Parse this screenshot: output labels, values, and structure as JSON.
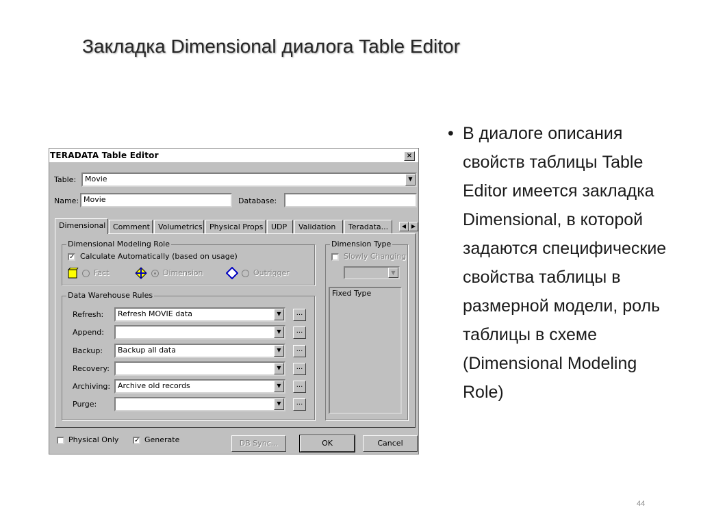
{
  "slide": {
    "title": "Закладка Dimensional диалога Table Editor",
    "bullet": "В диалоге описания свойств таблицы Table Editor имеется закладка Dimensional, в которой задаются специфические свойства таблицы в размерной модели, роль таблицы в схеме (Dimensional Modeling Role)",
    "page_number": "44"
  },
  "dialog": {
    "title": "TERADATA Table Editor",
    "close": "×",
    "table_label": "Table:",
    "table_value": "Movie",
    "name_label": "Name:",
    "name_value": "Movie",
    "database_label": "Database:",
    "database_value": "",
    "tabs": [
      "Dimensional",
      "Comment",
      "Volumetrics",
      "Physical Props",
      "UDP",
      "Validation",
      "Teradata..."
    ],
    "modeling_role": {
      "label": "Dimensional Modeling Role",
      "calc_auto": "Calculate Automatically (based on usage)",
      "calc_auto_checked": true,
      "fact": "Fact",
      "dimension": "Dimension",
      "outrigger": "Outrigger",
      "selected": "Dimension"
    },
    "dimension_type": {
      "label": "Dimension Type",
      "slowly_changing": "Slowly Changing",
      "slowly_changing_checked": false,
      "fixed_type": "Fixed Type"
    },
    "warehouse_rules": {
      "label": "Data Warehouse Rules",
      "rows": [
        {
          "label": "Refresh:",
          "value": "Refresh MOVIE data"
        },
        {
          "label": "Append:",
          "value": ""
        },
        {
          "label": "Backup:",
          "value": "Backup all data"
        },
        {
          "label": "Recovery:",
          "value": ""
        },
        {
          "label": "Archiving:",
          "value": "Archive old records"
        },
        {
          "label": "Purge:",
          "value": ""
        }
      ],
      "ellipsis": "..."
    },
    "physical_only": "Physical Only",
    "physical_only_checked": false,
    "generate": "Generate",
    "generate_checked": true,
    "db_sync": "DB Sync...",
    "ok": "OK",
    "cancel": "Cancel"
  }
}
